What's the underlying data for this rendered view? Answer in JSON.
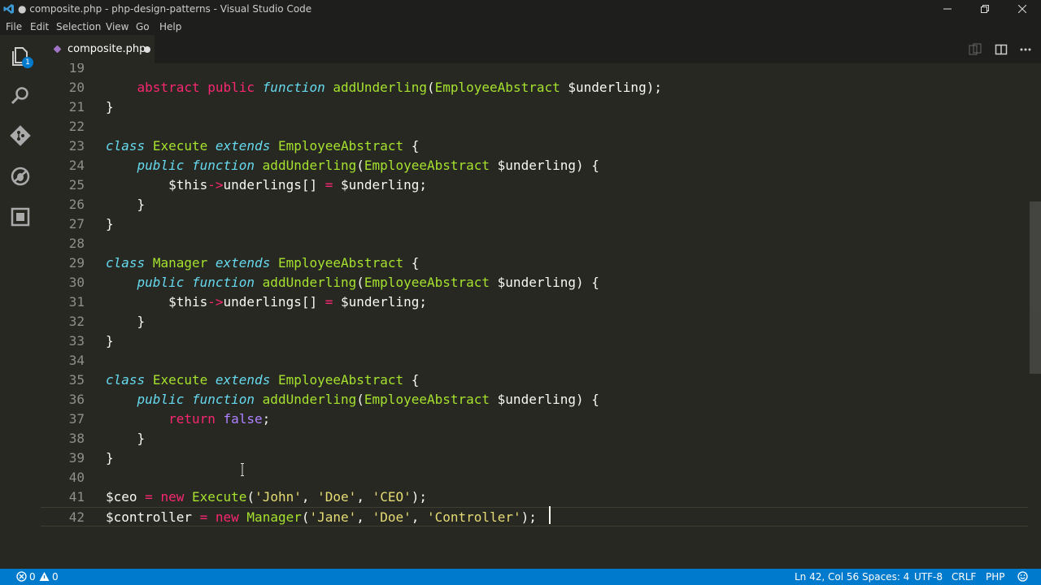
{
  "window": {
    "title": "● composite.php - php-design-patterns - Visual Studio Code"
  },
  "menu": [
    "File",
    "Edit",
    "Selection",
    "View",
    "Go",
    "Help"
  ],
  "activity": {
    "explorer_badge": "1"
  },
  "tab": {
    "filename": "composite.php"
  },
  "editor": {
    "lines": [
      {
        "n": "19",
        "tokens": []
      },
      {
        "n": "20",
        "tokens": [
          [
            "",
            "    "
          ],
          [
            "kw",
            "abstract"
          ],
          [
            "",
            " "
          ],
          [
            "kw",
            "public"
          ],
          [
            "",
            " "
          ],
          [
            "k",
            "function"
          ],
          [
            "",
            " "
          ],
          [
            "fn",
            "addUnderling"
          ],
          [
            "",
            "("
          ],
          [
            "fn",
            "EmployeeAbstract"
          ],
          [
            "",
            " $underling);"
          ]
        ]
      },
      {
        "n": "21",
        "tokens": [
          [
            "",
            "}"
          ]
        ]
      },
      {
        "n": "22",
        "tokens": []
      },
      {
        "n": "23",
        "tokens": [
          [
            "k",
            "class"
          ],
          [
            "",
            " "
          ],
          [
            "fn",
            "Execute"
          ],
          [
            "",
            " "
          ],
          [
            "k",
            "extends"
          ],
          [
            "",
            " "
          ],
          [
            "fn",
            "EmployeeAbstract"
          ],
          [
            "",
            " {"
          ]
        ]
      },
      {
        "n": "24",
        "tokens": [
          [
            "",
            "    "
          ],
          [
            "k",
            "public"
          ],
          [
            "",
            " "
          ],
          [
            "k",
            "function"
          ],
          [
            "",
            " "
          ],
          [
            "fn",
            "addUnderling"
          ],
          [
            "",
            "("
          ],
          [
            "fn",
            "EmployeeAbstract"
          ],
          [
            "",
            " $underling) {"
          ]
        ]
      },
      {
        "n": "25",
        "tokens": [
          [
            "",
            "        $this"
          ],
          [
            "kw",
            "->"
          ],
          [
            "",
            "underlings[] "
          ],
          [
            "kw",
            "="
          ],
          [
            "",
            " $underling;"
          ]
        ]
      },
      {
        "n": "26",
        "tokens": [
          [
            "",
            "    }"
          ]
        ]
      },
      {
        "n": "27",
        "tokens": [
          [
            "",
            "}"
          ]
        ]
      },
      {
        "n": "28",
        "tokens": []
      },
      {
        "n": "29",
        "tokens": [
          [
            "k",
            "class"
          ],
          [
            "",
            " "
          ],
          [
            "fn",
            "Manager"
          ],
          [
            "",
            " "
          ],
          [
            "k",
            "extends"
          ],
          [
            "",
            " "
          ],
          [
            "fn",
            "EmployeeAbstract"
          ],
          [
            "",
            " {"
          ]
        ]
      },
      {
        "n": "30",
        "tokens": [
          [
            "",
            "    "
          ],
          [
            "k",
            "public"
          ],
          [
            "",
            " "
          ],
          [
            "k",
            "function"
          ],
          [
            "",
            " "
          ],
          [
            "fn",
            "addUnderling"
          ],
          [
            "",
            "("
          ],
          [
            "fn",
            "EmployeeAbstract"
          ],
          [
            "",
            " $underling) {"
          ]
        ]
      },
      {
        "n": "31",
        "tokens": [
          [
            "",
            "        $this"
          ],
          [
            "kw",
            "->"
          ],
          [
            "",
            "underlings[] "
          ],
          [
            "kw",
            "="
          ],
          [
            "",
            " $underling;"
          ]
        ]
      },
      {
        "n": "32",
        "tokens": [
          [
            "",
            "    }"
          ]
        ]
      },
      {
        "n": "33",
        "tokens": [
          [
            "",
            "}"
          ]
        ]
      },
      {
        "n": "34",
        "tokens": []
      },
      {
        "n": "35",
        "tokens": [
          [
            "k",
            "class"
          ],
          [
            "",
            " "
          ],
          [
            "fn",
            "Execute"
          ],
          [
            "",
            " "
          ],
          [
            "k",
            "extends"
          ],
          [
            "",
            " "
          ],
          [
            "fn",
            "EmployeeAbstract"
          ],
          [
            "",
            " {"
          ]
        ]
      },
      {
        "n": "36",
        "tokens": [
          [
            "",
            "    "
          ],
          [
            "k",
            "public"
          ],
          [
            "",
            " "
          ],
          [
            "k",
            "function"
          ],
          [
            "",
            " "
          ],
          [
            "fn",
            "addUnderling"
          ],
          [
            "",
            "("
          ],
          [
            "fn",
            "EmployeeAbstract"
          ],
          [
            "",
            " $underling) {"
          ]
        ]
      },
      {
        "n": "37",
        "tokens": [
          [
            "",
            "        "
          ],
          [
            "kw",
            "return"
          ],
          [
            "",
            " "
          ],
          [
            "num",
            "false"
          ],
          [
            "",
            ";"
          ]
        ]
      },
      {
        "n": "38",
        "tokens": [
          [
            "",
            "    }"
          ]
        ]
      },
      {
        "n": "39",
        "tokens": [
          [
            "",
            "}"
          ]
        ]
      },
      {
        "n": "40",
        "tokens": []
      },
      {
        "n": "41",
        "tokens": [
          [
            "",
            "$ceo "
          ],
          [
            "kw",
            "="
          ],
          [
            "",
            " "
          ],
          [
            "kw",
            "new"
          ],
          [
            "",
            " "
          ],
          [
            "fn",
            "Execute"
          ],
          [
            "",
            "("
          ],
          [
            "str",
            "'John'"
          ],
          [
            "",
            ", "
          ],
          [
            "str",
            "'Doe'"
          ],
          [
            "",
            ", "
          ],
          [
            "str",
            "'CEO'"
          ],
          [
            "",
            ");"
          ]
        ]
      },
      {
        "n": "42",
        "tokens": [
          [
            "",
            "$controller "
          ],
          [
            "kw",
            "="
          ],
          [
            "",
            " "
          ],
          [
            "kw",
            "new"
          ],
          [
            "",
            " "
          ],
          [
            "fn",
            "Manager"
          ],
          [
            "",
            "("
          ],
          [
            "str",
            "'Jane'"
          ],
          [
            "",
            ", "
          ],
          [
            "str",
            "'Doe'"
          ],
          [
            "",
            ", "
          ],
          [
            "str",
            "'Controller'"
          ],
          [
            "",
            ");"
          ]
        ]
      }
    ]
  },
  "status": {
    "errors": "0",
    "warnings": "0",
    "position": "Ln 42, Col 56",
    "spaces": "Spaces: 4",
    "encoding": "UTF-8",
    "eol": "CRLF",
    "language": "PHP"
  },
  "colors": {
    "editor_bg": "#272822",
    "status_bg": "#007acc",
    "keyword": "#f92672",
    "type": "#66d9ef",
    "function": "#a6e22e",
    "string": "#e6db74"
  }
}
